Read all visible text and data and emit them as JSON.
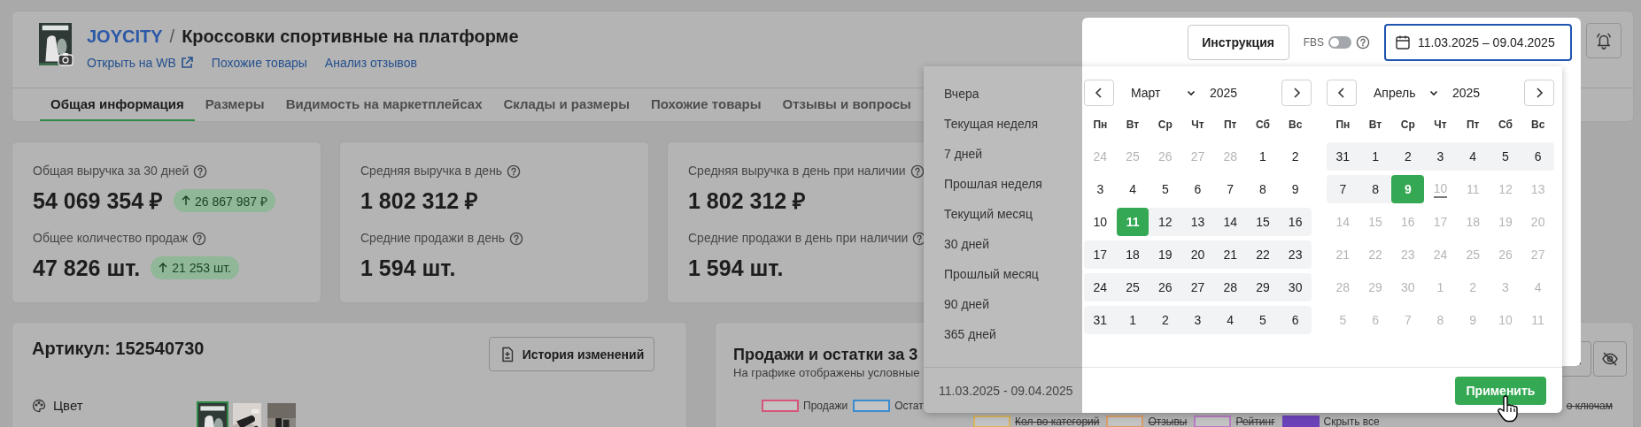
{
  "product": {
    "brand": "JOYCITY",
    "separator": "/",
    "title": "Кроссовки спортивные на платформе",
    "links": [
      {
        "label": "Открыть на WB",
        "external": true
      },
      {
        "label": "Похожие товары",
        "external": false
      },
      {
        "label": "Анализ отзывов",
        "external": false
      }
    ]
  },
  "tabs": [
    {
      "label": "Общая информация",
      "selected": true
    },
    {
      "label": "Размеры",
      "selected": false
    },
    {
      "label": "Видимость на маркетплейсах",
      "selected": false
    },
    {
      "label": "Склады и размеры",
      "selected": false
    },
    {
      "label": "Похожие товары",
      "selected": false
    },
    {
      "label": "Отзывы и вопросы",
      "selected": false
    }
  ],
  "stats": [
    {
      "items": [
        {
          "label": "Общая выручка за 30 дней",
          "value": "54 069 354 ₽",
          "delta": "26 867 987 ₽"
        },
        {
          "label": "Общее количество продаж",
          "value": "47 826 шт.",
          "delta": "21 253 шт."
        }
      ]
    },
    {
      "items": [
        {
          "label": "Средняя выручка в день",
          "value": "1 802 312 ₽"
        },
        {
          "label": "Средние продажи в день",
          "value": "1 594 шт."
        }
      ]
    },
    {
      "items": [
        {
          "label": "Средняя выручка в день при наличии",
          "value": "1 802 312 ₽"
        },
        {
          "label": "Средние продажи в день при наличии",
          "value": "1 594 шт."
        }
      ]
    }
  ],
  "article_card": {
    "title": "Артикул: 152540730",
    "history_button": "История изменений",
    "color_label": "Цвет",
    "thumbnails": [
      {
        "kind": "picture",
        "selected": true
      },
      {
        "kind": "picture",
        "selected": false
      },
      {
        "kind": "picture",
        "selected": false
      }
    ]
  },
  "sales_card": {
    "title": "Продажи и остатки за 3",
    "subtitle": "На графике отображены условные",
    "legend": [
      {
        "kind": "series",
        "label": "Продажи",
        "color": "#d8557a",
        "hidden": false
      },
      {
        "kind": "series",
        "label": "Остат",
        "color": "#3a8bd0",
        "hidden": false
      },
      {
        "kind": "text",
        "label": "о ключам",
        "hidden": true
      }
    ],
    "legend_more": [
      {
        "kind": "series",
        "label": "Кол-во категорий",
        "color": "#d9b25c",
        "hidden": true
      },
      {
        "kind": "series",
        "label": "Отзывы",
        "color": "#d99d66",
        "hidden": true
      },
      {
        "kind": "series",
        "label": "Рейтинг",
        "color": "#b87bc4",
        "hidden": true
      },
      {
        "kind": "hide_all",
        "label": "Скрыть все",
        "color": "#6b42b8",
        "hidden": false
      }
    ]
  },
  "toolbar": {
    "instruction_button": "Инструкция",
    "fbs": {
      "label": "FBS",
      "on": false
    },
    "date_range": "11.03.2025 – 09.04.2025"
  },
  "date_picker": {
    "presets": [
      "Вчера",
      "Текущая неделя",
      "7 дней",
      "Прошлая неделя",
      "Текущий месяц",
      "30 дней",
      "Прошлый месяц",
      "90 дней",
      "365 дней"
    ],
    "footer_range": "11.03.2025 - 09.04.2025",
    "apply_button": "Применить",
    "months": [
      {
        "month": "Март",
        "year": "2025",
        "weekdays": [
          "Пн",
          "Вт",
          "Ср",
          "Чт",
          "Пт",
          "Сб",
          "Вс"
        ],
        "weeks": [
          [
            {
              "day": "24",
              "muted": true,
              "in_range": false,
              "selected": false,
              "today": false
            },
            {
              "day": "25",
              "muted": true,
              "in_range": false,
              "selected": false,
              "today": false
            },
            {
              "day": "26",
              "muted": true,
              "in_range": false,
              "selected": false,
              "today": false
            },
            {
              "day": "27",
              "muted": true,
              "in_range": false,
              "selected": false,
              "today": false
            },
            {
              "day": "28",
              "muted": true,
              "in_range": false,
              "selected": false,
              "today": false
            },
            {
              "day": "1",
              "muted": false,
              "in_range": false,
              "selected": false,
              "today": false
            },
            {
              "day": "2",
              "muted": false,
              "in_range": false,
              "selected": false,
              "today": false
            }
          ],
          [
            {
              "day": "3",
              "muted": false,
              "in_range": false,
              "selected": false,
              "today": false
            },
            {
              "day": "4",
              "muted": false,
              "in_range": false,
              "selected": false,
              "today": false
            },
            {
              "day": "5",
              "muted": false,
              "in_range": false,
              "selected": false,
              "today": false
            },
            {
              "day": "6",
              "muted": false,
              "in_range": false,
              "selected": false,
              "today": false
            },
            {
              "day": "7",
              "muted": false,
              "in_range": false,
              "selected": false,
              "today": false
            },
            {
              "day": "8",
              "muted": false,
              "in_range": false,
              "selected": false,
              "today": false
            },
            {
              "day": "9",
              "muted": false,
              "in_range": false,
              "selected": false,
              "today": false
            }
          ],
          [
            {
              "day": "10",
              "muted": false,
              "in_range": false,
              "selected": false,
              "today": false
            },
            {
              "day": "11",
              "muted": false,
              "in_range": true,
              "selected": true,
              "today": false
            },
            {
              "day": "12",
              "muted": false,
              "in_range": true,
              "selected": false,
              "today": false
            },
            {
              "day": "13",
              "muted": false,
              "in_range": true,
              "selected": false,
              "today": false
            },
            {
              "day": "14",
              "muted": false,
              "in_range": true,
              "selected": false,
              "today": false
            },
            {
              "day": "15",
              "muted": false,
              "in_range": true,
              "selected": false,
              "today": false
            },
            {
              "day": "16",
              "muted": false,
              "in_range": true,
              "selected": false,
              "today": false
            }
          ],
          [
            {
              "day": "17",
              "muted": false,
              "in_range": true,
              "selected": false,
              "today": false
            },
            {
              "day": "18",
              "muted": false,
              "in_range": true,
              "selected": false,
              "today": false
            },
            {
              "day": "19",
              "muted": false,
              "in_range": true,
              "selected": false,
              "today": false
            },
            {
              "day": "20",
              "muted": false,
              "in_range": true,
              "selected": false,
              "today": false
            },
            {
              "day": "21",
              "muted": false,
              "in_range": true,
              "selected": false,
              "today": false
            },
            {
              "day": "22",
              "muted": false,
              "in_range": true,
              "selected": false,
              "today": false
            },
            {
              "day": "23",
              "muted": false,
              "in_range": true,
              "selected": false,
              "today": false
            }
          ],
          [
            {
              "day": "24",
              "muted": false,
              "in_range": true,
              "selected": false,
              "today": false
            },
            {
              "day": "25",
              "muted": false,
              "in_range": true,
              "selected": false,
              "today": false
            },
            {
              "day": "26",
              "muted": false,
              "in_range": true,
              "selected": false,
              "today": false
            },
            {
              "day": "27",
              "muted": false,
              "in_range": true,
              "selected": false,
              "today": false
            },
            {
              "day": "28",
              "muted": false,
              "in_range": true,
              "selected": false,
              "today": false
            },
            {
              "day": "29",
              "muted": false,
              "in_range": true,
              "selected": false,
              "today": false
            },
            {
              "day": "30",
              "muted": false,
              "in_range": true,
              "selected": false,
              "today": false
            }
          ],
          [
            {
              "day": "31",
              "muted": false,
              "in_range": true,
              "selected": false,
              "today": false
            },
            {
              "day": "1",
              "muted": false,
              "in_range": true,
              "selected": false,
              "today": false
            },
            {
              "day": "2",
              "muted": false,
              "in_range": true,
              "selected": false,
              "today": false
            },
            {
              "day": "3",
              "muted": false,
              "in_range": true,
              "selected": false,
              "today": false
            },
            {
              "day": "4",
              "muted": false,
              "in_range": true,
              "selected": false,
              "today": false
            },
            {
              "day": "5",
              "muted": false,
              "in_range": true,
              "selected": false,
              "today": false
            },
            {
              "day": "6",
              "muted": false,
              "in_range": true,
              "selected": false,
              "today": false
            }
          ]
        ]
      },
      {
        "month": "Апрель",
        "year": "2025",
        "weekdays": [
          "Пн",
          "Вт",
          "Ср",
          "Чт",
          "Пт",
          "Сб",
          "Вс"
        ],
        "weeks": [
          [
            {
              "day": "31",
              "muted": false,
              "in_range": true,
              "selected": false,
              "today": false
            },
            {
              "day": "1",
              "muted": false,
              "in_range": true,
              "selected": false,
              "today": false
            },
            {
              "day": "2",
              "muted": false,
              "in_range": true,
              "selected": false,
              "today": false
            },
            {
              "day": "3",
              "muted": false,
              "in_range": true,
              "selected": false,
              "today": false
            },
            {
              "day": "4",
              "muted": false,
              "in_range": true,
              "selected": false,
              "today": false
            },
            {
              "day": "5",
              "muted": false,
              "in_range": true,
              "selected": false,
              "today": false
            },
            {
              "day": "6",
              "muted": false,
              "in_range": true,
              "selected": false,
              "today": false
            }
          ],
          [
            {
              "day": "7",
              "muted": false,
              "in_range": true,
              "selected": false,
              "today": false
            },
            {
              "day": "8",
              "muted": false,
              "in_range": true,
              "selected": false,
              "today": false
            },
            {
              "day": "9",
              "muted": false,
              "in_range": true,
              "selected": true,
              "today": false
            },
            {
              "day": "10",
              "muted": true,
              "in_range": false,
              "selected": false,
              "today": true
            },
            {
              "day": "11",
              "muted": true,
              "in_range": false,
              "selected": false,
              "today": false
            },
            {
              "day": "12",
              "muted": true,
              "in_range": false,
              "selected": false,
              "today": false
            },
            {
              "day": "13",
              "muted": true,
              "in_range": false,
              "selected": false,
              "today": false
            }
          ],
          [
            {
              "day": "14",
              "muted": true,
              "in_range": false,
              "selected": false,
              "today": false
            },
            {
              "day": "15",
              "muted": true,
              "in_range": false,
              "selected": false,
              "today": false
            },
            {
              "day": "16",
              "muted": true,
              "in_range": false,
              "selected": false,
              "today": false
            },
            {
              "day": "17",
              "muted": true,
              "in_range": false,
              "selected": false,
              "today": false
            },
            {
              "day": "18",
              "muted": true,
              "in_range": false,
              "selected": false,
              "today": false
            },
            {
              "day": "19",
              "muted": true,
              "in_range": false,
              "selected": false,
              "today": false
            },
            {
              "day": "20",
              "muted": true,
              "in_range": false,
              "selected": false,
              "today": false
            }
          ],
          [
            {
              "day": "21",
              "muted": true,
              "in_range": false,
              "selected": false,
              "today": false
            },
            {
              "day": "22",
              "muted": true,
              "in_range": false,
              "selected": false,
              "today": false
            },
            {
              "day": "23",
              "muted": true,
              "in_range": false,
              "selected": false,
              "today": false
            },
            {
              "day": "24",
              "muted": true,
              "in_range": false,
              "selected": false,
              "today": false
            },
            {
              "day": "25",
              "muted": true,
              "in_range": false,
              "selected": false,
              "today": false
            },
            {
              "day": "26",
              "muted": true,
              "in_range": false,
              "selected": false,
              "today": false
            },
            {
              "day": "27",
              "muted": true,
              "in_range": false,
              "selected": false,
              "today": false
            }
          ],
          [
            {
              "day": "28",
              "muted": true,
              "in_range": false,
              "selected": false,
              "today": false
            },
            {
              "day": "29",
              "muted": true,
              "in_range": false,
              "selected": false,
              "today": false
            },
            {
              "day": "30",
              "muted": true,
              "in_range": false,
              "selected": false,
              "today": false
            },
            {
              "day": "1",
              "muted": true,
              "in_range": false,
              "selected": false,
              "today": false
            },
            {
              "day": "2",
              "muted": true,
              "in_range": false,
              "selected": false,
              "today": false
            },
            {
              "day": "3",
              "muted": true,
              "in_range": false,
              "selected": false,
              "today": false
            },
            {
              "day": "4",
              "muted": true,
              "in_range": false,
              "selected": false,
              "today": false
            }
          ],
          [
            {
              "day": "5",
              "muted": true,
              "in_range": false,
              "selected": false,
              "today": false
            },
            {
              "day": "6",
              "muted": true,
              "in_range": false,
              "selected": false,
              "today": false
            },
            {
              "day": "7",
              "muted": true,
              "in_range": false,
              "selected": false,
              "today": false
            },
            {
              "day": "8",
              "muted": true,
              "in_range": false,
              "selected": false,
              "today": false
            },
            {
              "day": "9",
              "muted": true,
              "in_range": false,
              "selected": false,
              "today": false
            },
            {
              "day": "10",
              "muted": true,
              "in_range": false,
              "selected": false,
              "today": false
            },
            {
              "day": "11",
              "muted": true,
              "in_range": false,
              "selected": false,
              "today": false
            }
          ]
        ]
      }
    ]
  }
}
